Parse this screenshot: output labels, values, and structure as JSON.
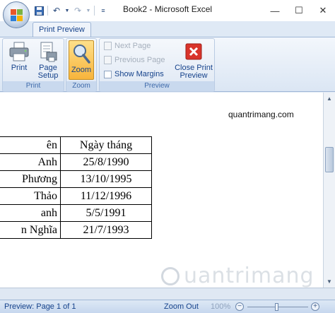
{
  "window": {
    "title": "Book2 - Microsoft Excel"
  },
  "ribbon": {
    "tab": "Print Preview",
    "print_group": {
      "print_label": "Print",
      "page_setup_label": "Page\nSetup",
      "group_label": "Print"
    },
    "zoom_group": {
      "zoom_label": "Zoom",
      "group_label": "Zoom"
    },
    "preview_group": {
      "next_page_label": "Next Page",
      "previous_page_label": "Previous Page",
      "show_margins_label": "Show Margins",
      "close_label": "Close Print\nPreview",
      "group_label": "Preview"
    }
  },
  "page": {
    "header_text": "quantrimang.com",
    "table": [
      {
        "name": "ên",
        "date": "Ngày tháng"
      },
      {
        "name": "Anh",
        "date": "25/8/1990"
      },
      {
        "name": "Phương",
        "date": "13/10/1995"
      },
      {
        "name": "Thảo",
        "date": "11/12/1996"
      },
      {
        "name": "anh",
        "date": "5/5/1991"
      },
      {
        "name": "n Nghĩa",
        "date": "21/7/1993"
      }
    ],
    "watermark": "uantrimang"
  },
  "status_bar": {
    "preview_text": "Preview: Page 1 of 1",
    "zoom_out_label": "Zoom Out",
    "zoom_percent": "100%"
  },
  "colors": {
    "ribbon_text": "#15428b",
    "zoom_active": "#f7b43c"
  }
}
